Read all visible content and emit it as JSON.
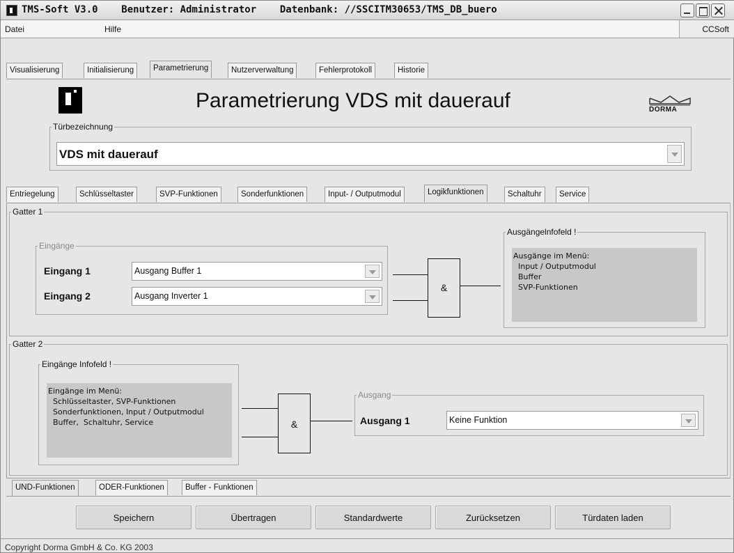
{
  "window": {
    "title": "TMS-Soft V3.0    Benutzer: Administrator    Datenbank: //SSCITM30653/TMS_DB_buero",
    "controls": [
      "minimize-icon",
      "maximize-icon",
      "close-icon"
    ]
  },
  "menu": {
    "items": [
      "Datei",
      "Hilfe"
    ],
    "right": "CCSoft"
  },
  "top_tabs": [
    "Visualisierung",
    "Initialisierung",
    "Parametrierung",
    "Nutzerverwaltung",
    "Fehlerprotokoll",
    "Historie"
  ],
  "top_tabs_active": "Parametrierung",
  "header": {
    "title": "Parametrierung  VDS mit dauerauf",
    "brand": "DORMA"
  },
  "door": {
    "legend": "Türbezeichnung",
    "value": "VDS mit dauerauf"
  },
  "sub_tabs": [
    "Entriegelung",
    "Schlüsseltaster",
    "SVP-Funktionen",
    "Sonderfunktionen",
    "Input- / Outputmodul",
    "Logikfunktionen",
    "Schaltuhr",
    "Service"
  ],
  "sub_tabs_active": "Logikfunktionen",
  "gatter1": {
    "legend": "Gatter 1",
    "inputs_legend": "Eingänge",
    "input1_label": "Eingang 1",
    "input1_value": "Ausgang Buffer 1",
    "input2_label": "Eingang 2",
    "input2_value": "Ausgang Inverter 1",
    "gate_symbol": "&",
    "info_legend": "Ausgängelnfofeld !",
    "info_lines": [
      "Ausgänge im Menü:",
      "  Input / Outputmodul",
      "  Buffer",
      "  SVP-Funktionen"
    ]
  },
  "gatter2": {
    "legend": "Gatter 2",
    "info_legend": "Eingänge Infofeld !",
    "info_lines": [
      "Eingänge im Menü:",
      "  Schlüsseltaster, SVP-Funktionen",
      "  Sonderfunktionen, Input / Outputmodul",
      "  Buffer,  Schaltuhr, Service"
    ],
    "gate_symbol": "&",
    "output_legend": "Ausgang",
    "output1_label": "Ausgang 1",
    "output1_value": "Keine Funktion"
  },
  "bottom_tabs": [
    "UND-Funktionen",
    "ODER-Funktionen",
    "Buffer - Funktionen"
  ],
  "bottom_tabs_active": "UND-Funktionen",
  "buttons": {
    "save": "Speichern",
    "transfer": "Übertragen",
    "defaults": "Standardwerte",
    "reset": "Zurücksetzen",
    "load": "Türdaten laden"
  },
  "status": {
    "copyright": "Copyright Dorma GmbH & Co. KG 2003"
  }
}
